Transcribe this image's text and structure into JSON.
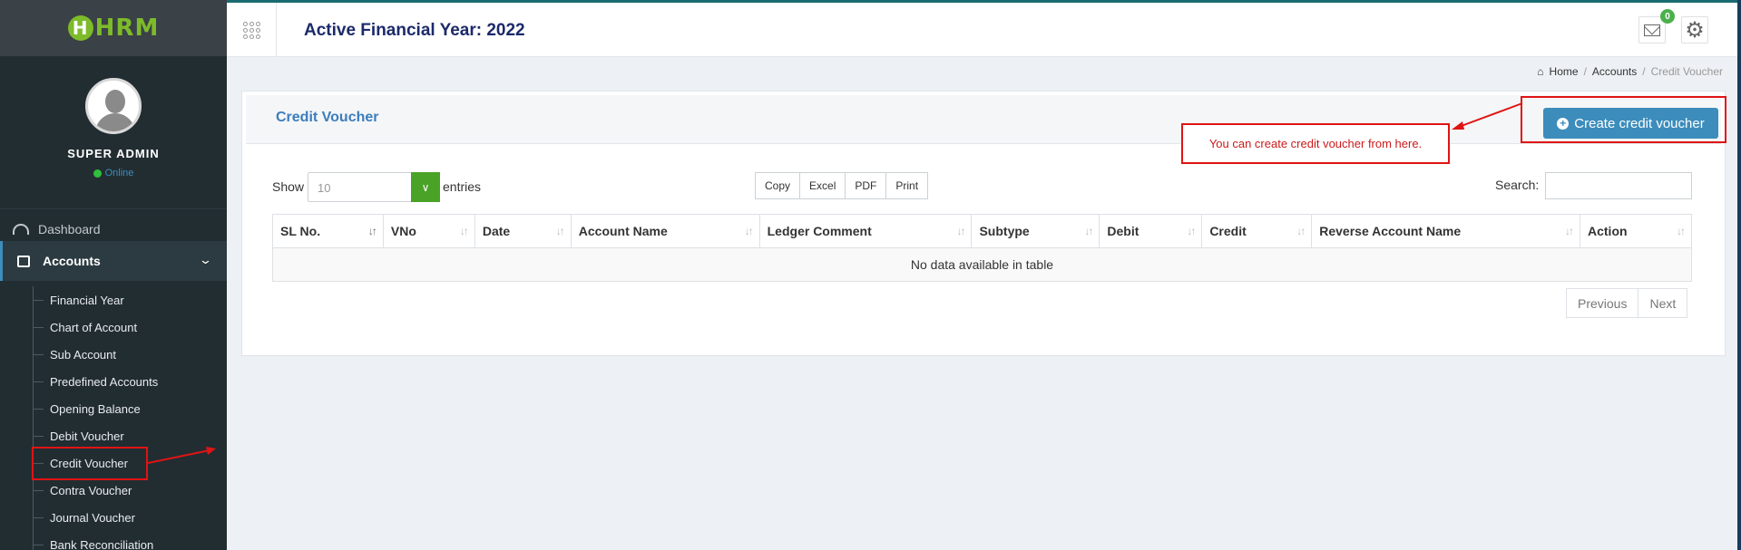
{
  "app": {
    "logo_text": "HRM",
    "logo_mark": "H"
  },
  "profile": {
    "name": "SUPER ADMIN",
    "status": "Online"
  },
  "sidebar": {
    "dashboard_label": "Dashboard",
    "accounts_label": "Accounts",
    "sub_items": [
      "Financial Year",
      "Chart of Account",
      "Sub Account",
      "Predefined Accounts",
      "Opening Balance",
      "Debit Voucher",
      "Credit Voucher",
      "Contra Voucher",
      "Journal Voucher",
      "Bank Reconciliation"
    ]
  },
  "header": {
    "title": "Active Financial Year: 2022",
    "mail_badge": "0"
  },
  "breadcrumb": {
    "home": "Home",
    "section": "Accounts",
    "current": "Credit Voucher",
    "sep": "/"
  },
  "panel": {
    "title": "Credit Voucher",
    "create_label": "Create credit voucher",
    "annotation": "You can create credit voucher from here."
  },
  "table_controls": {
    "show_label": "Show",
    "page_size": "10",
    "entries_label": "entries",
    "export_buttons": [
      "Copy",
      "Excel",
      "PDF",
      "Print"
    ],
    "search_label": "Search:",
    "search_value": ""
  },
  "table": {
    "columns": [
      "SL No.",
      "VNo",
      "Date",
      "Account Name",
      "Ledger Comment",
      "Subtype",
      "Debit",
      "Credit",
      "Reverse Account Name",
      "Action"
    ],
    "empty_message": "No data available in table"
  },
  "pagination": {
    "previous": "Previous",
    "next": "Next"
  },
  "colors": {
    "sidebar_bg": "#222d32",
    "accent": "#3c8dbc",
    "annotation_red": "#e01414",
    "green": "#4aa327"
  }
}
